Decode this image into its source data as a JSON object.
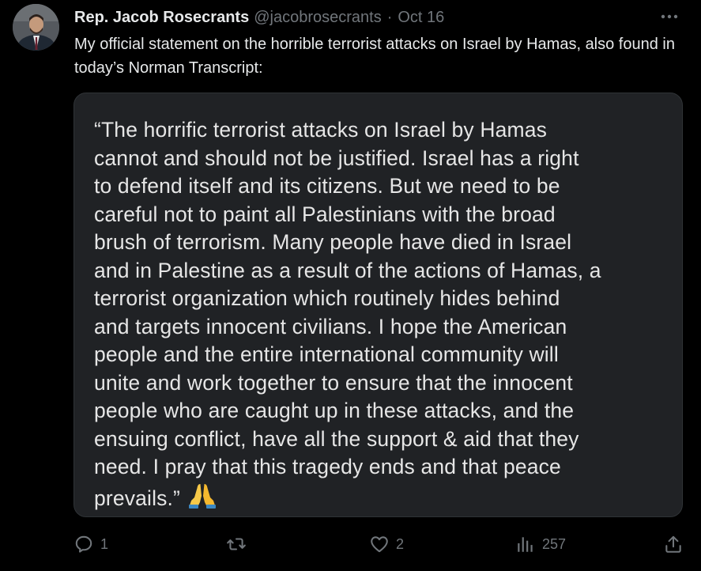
{
  "author": {
    "display_name": "Rep. Jacob Rosecrants",
    "handle": "@jacobrosecrants",
    "separator": "·",
    "date": "Oct 16"
  },
  "tweet": {
    "text": "My official statement on the horrible terrorist attacks on Israel by Hamas, also found in today’s Norman Transcript:"
  },
  "statement": {
    "lines": [
      "“The horrific terrorist attacks on Israel by Hamas",
      "cannot and should not be justified. Israel has a right",
      "to defend itself and its citizens. But we need to be",
      "careful not to paint all Palestinians with the broad",
      "brush of terrorism. Many people have died in Israel",
      "and in Palestine as a result of the actions of Hamas, a",
      "terrorist organization which routinely hides behind",
      "and targets innocent civilians. I hope the American",
      "people and the entire international community will",
      "unite and work together to ensure that the innocent",
      "people who are caught up in these attacks, and the",
      "ensuing conflict, have all the support & aid that they",
      "need. I pray that this tragedy ends and that peace",
      "prevails.”"
    ],
    "emoji": "folded-hands-icon"
  },
  "actions": {
    "replies": "1",
    "reposts": "",
    "likes": "2",
    "views": "257"
  },
  "colors": {
    "background": "#000000",
    "text": "#e7e9ea",
    "muted": "#71767b",
    "card": "#202225"
  }
}
